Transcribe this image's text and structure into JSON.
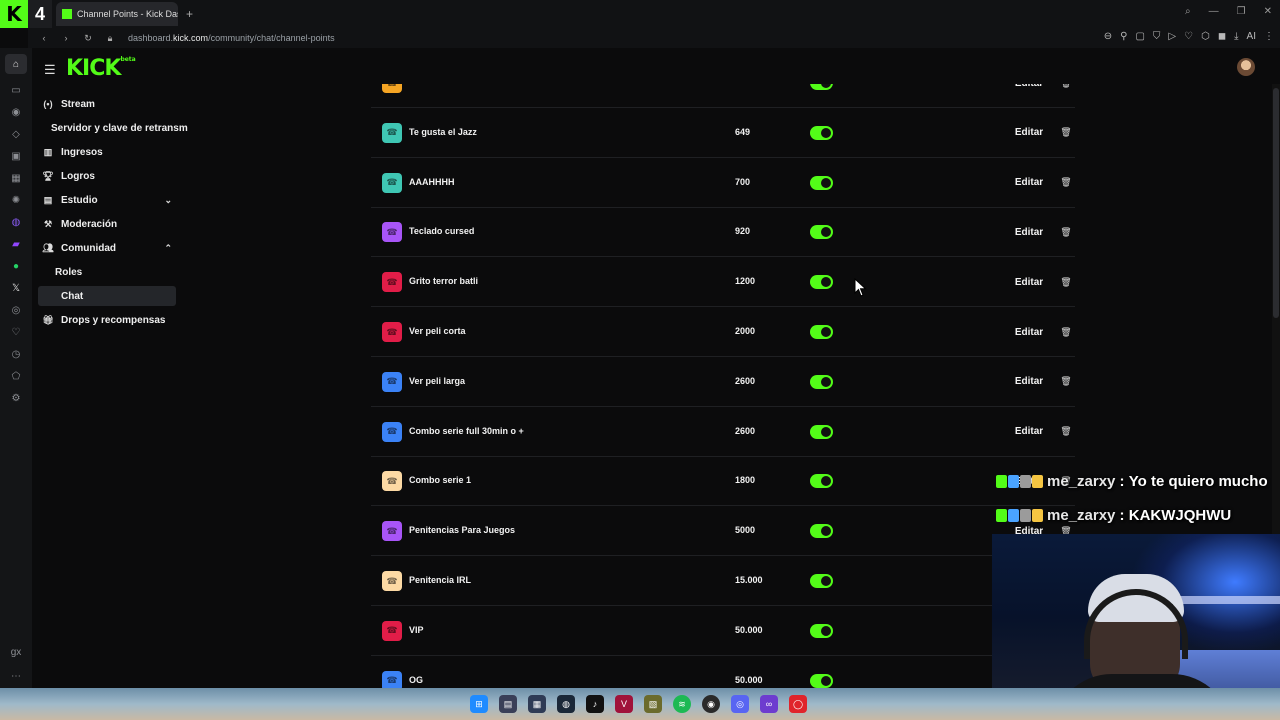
{
  "browser": {
    "workspace_number": "4",
    "tab_title": "Channel Points - Kick Das",
    "new_tab_label": "+",
    "url_prefix": "dashboard.",
    "url_domain": "kick.com",
    "url_path": "/community/chat/channel-points",
    "ai_label": "AI"
  },
  "sidebar": {
    "logo": "KICK",
    "logo_badge": "beta",
    "items": [
      {
        "label": "Stream",
        "icon": "broadcast-icon"
      },
      {
        "label": "Servidor y clave de retransm",
        "icon": ""
      },
      {
        "label": "Ingresos",
        "icon": "chart-icon"
      },
      {
        "label": "Logros",
        "icon": "trophy-icon"
      },
      {
        "label": "Estudio",
        "icon": "studio-icon"
      },
      {
        "label": "Moderación",
        "icon": "hammer-icon"
      },
      {
        "label": "Comunidad",
        "icon": "people-icon"
      },
      {
        "label": "Roles",
        "icon": ""
      },
      {
        "label": "Chat",
        "icon": ""
      },
      {
        "label": "Drops y recompensas",
        "icon": "gift-icon"
      }
    ]
  },
  "rewards": {
    "edit_label": "Editar",
    "rows": [
      {
        "name": "",
        "cost": "",
        "color": "#f5a524"
      },
      {
        "name": "Te gusta el Jazz",
        "cost": "649",
        "color": "#3fc7b4"
      },
      {
        "name": "AAAHHHH",
        "cost": "700",
        "color": "#3fc7b4"
      },
      {
        "name": "Teclado cursed",
        "cost": "920",
        "color": "#a855f7"
      },
      {
        "name": "Grito terror batli",
        "cost": "1200",
        "color": "#e11d48"
      },
      {
        "name": "Ver peli corta",
        "cost": "2000",
        "color": "#e11d48"
      },
      {
        "name": "Ver peli larga",
        "cost": "2600",
        "color": "#3b82f6"
      },
      {
        "name": "Combo serie full 30min o +",
        "cost": "2600",
        "color": "#3b82f6"
      },
      {
        "name": "Combo serie 1",
        "cost": "1800",
        "color": "#fcd9a4"
      },
      {
        "name": "Penitencias Para Juegos",
        "cost": "5000",
        "color": "#a855f7"
      },
      {
        "name": "Penitencia IRL",
        "cost": "15.000",
        "color": "#fcd9a4"
      },
      {
        "name": "VIP",
        "cost": "50.000",
        "color": "#e11d48"
      },
      {
        "name": "OG",
        "cost": "50.000",
        "color": "#3b82f6"
      }
    ]
  },
  "overlay_chat": [
    {
      "user": "me_zarxy",
      "message": "Yo te quiero mucho"
    },
    {
      "user": "me_zarxy",
      "message": "KAKWJQHWU"
    }
  ],
  "overlay_separator": " : ",
  "colors": {
    "accent": "#53fc18",
    "background": "#0b0b0c"
  }
}
